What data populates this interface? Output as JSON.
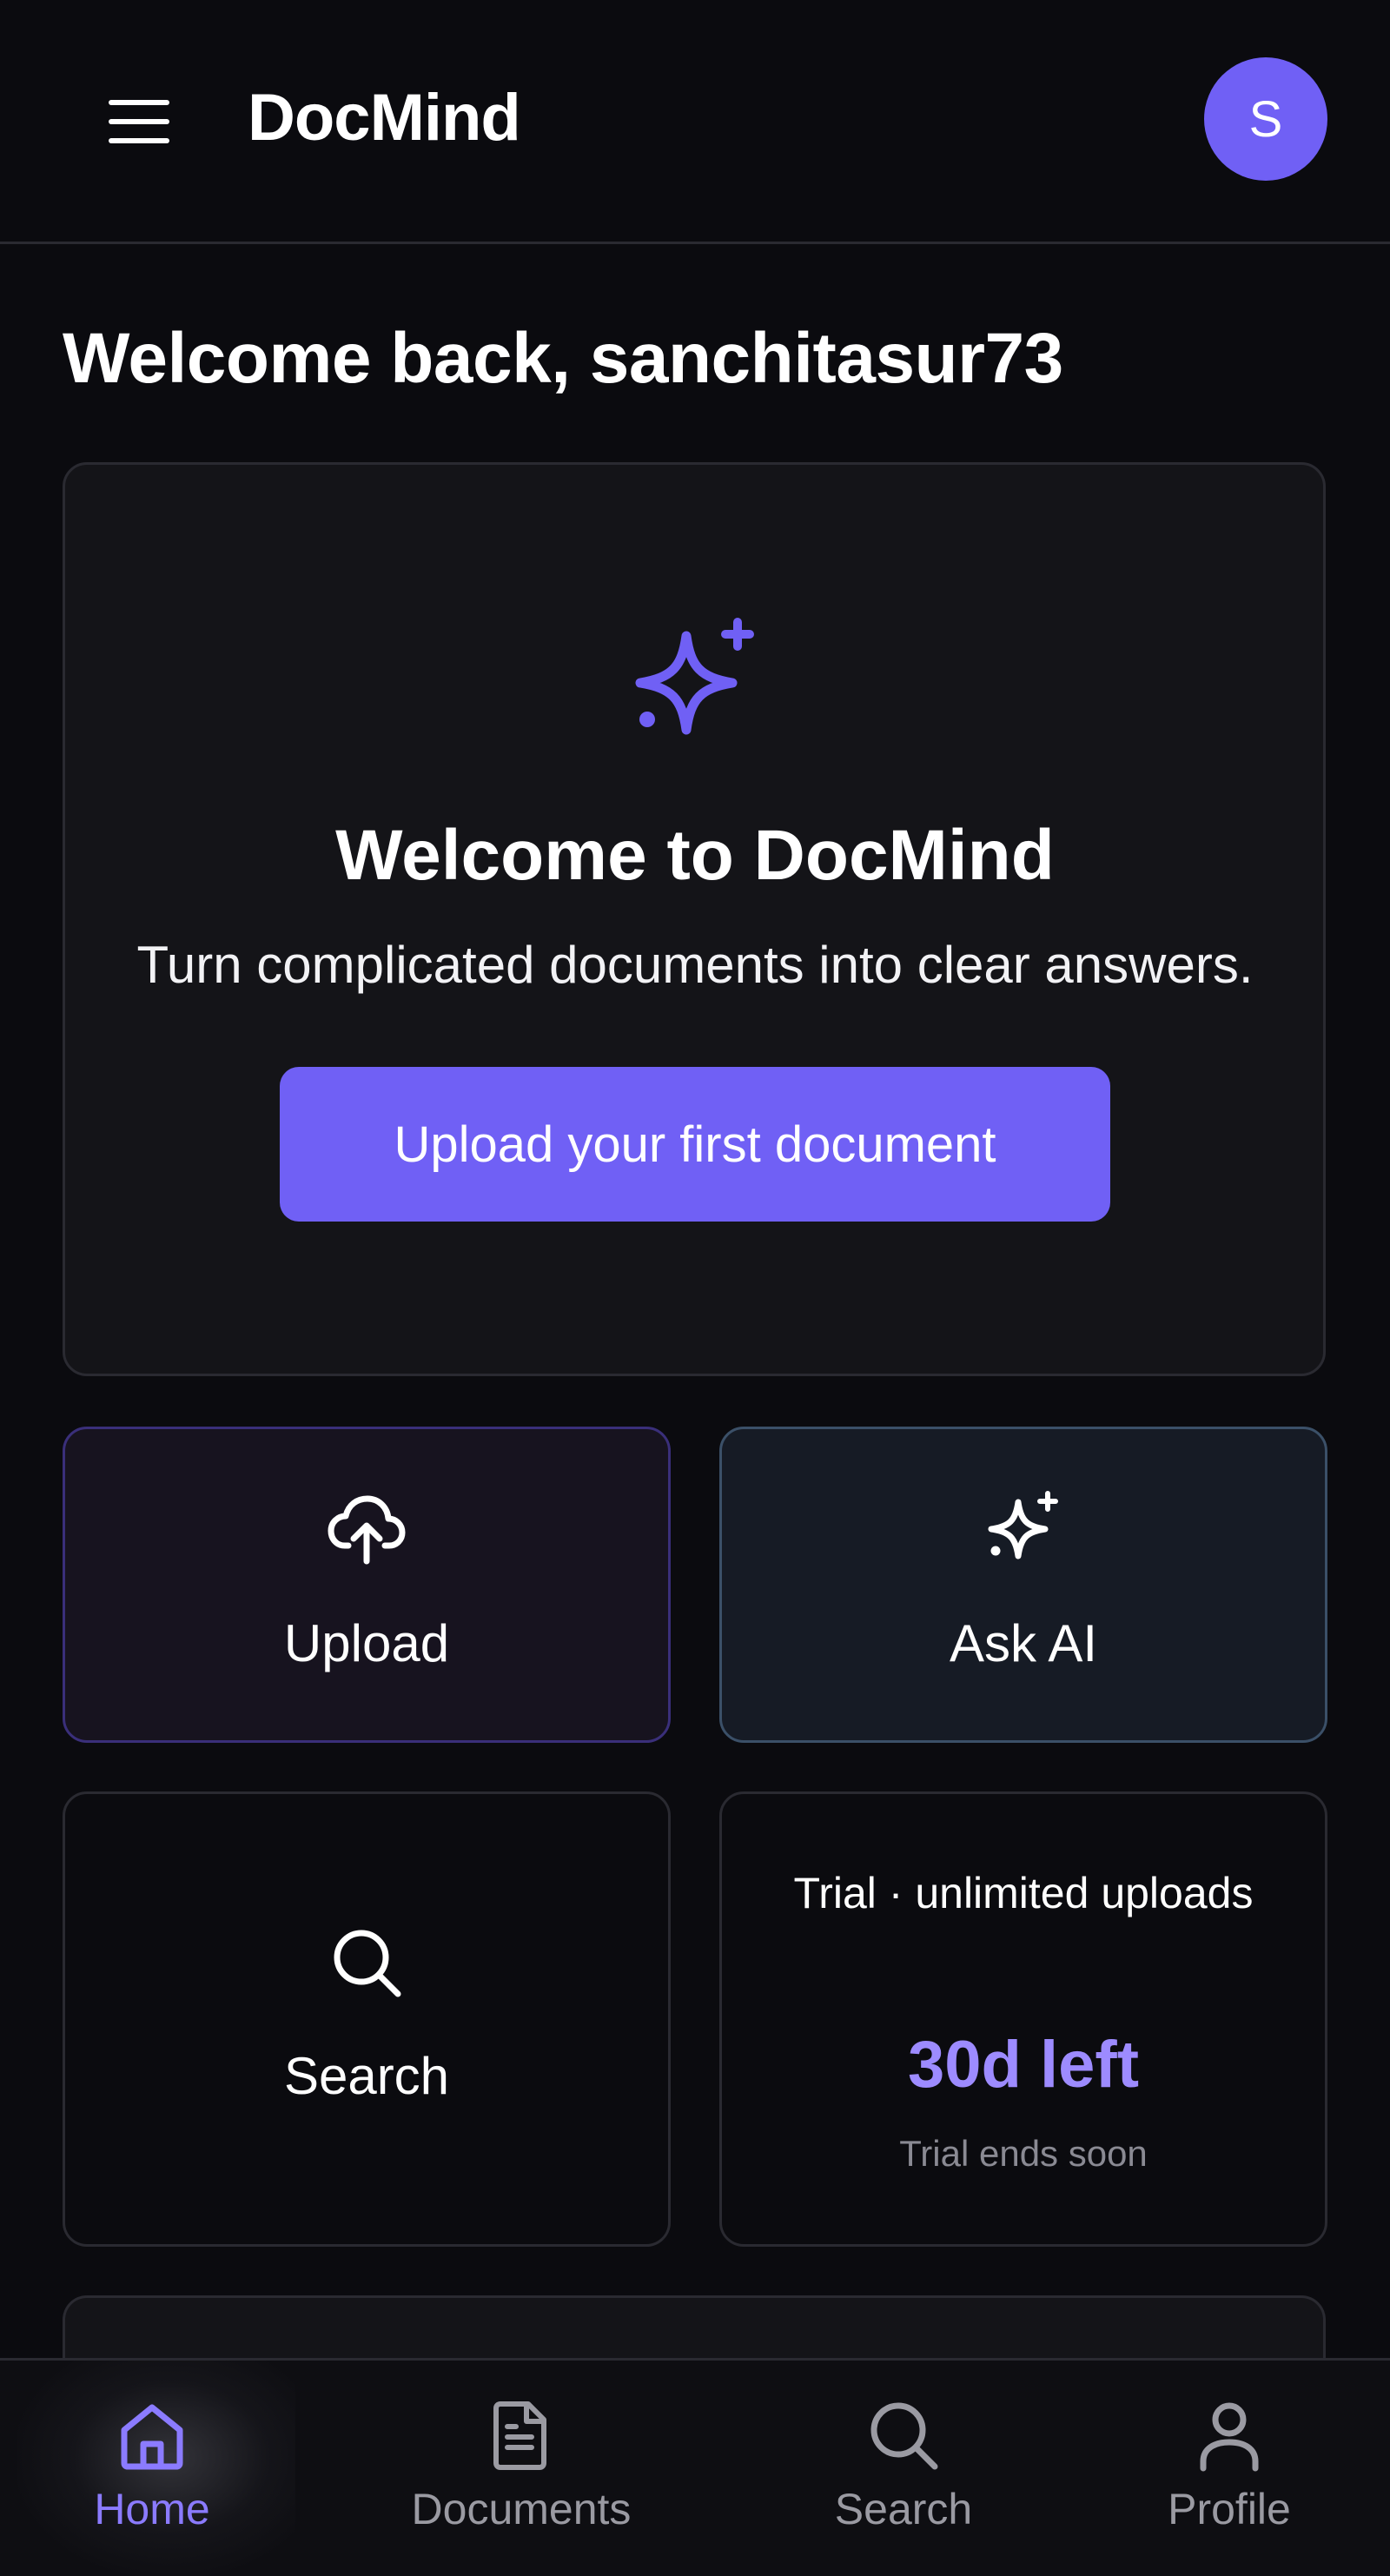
{
  "app": {
    "title": "DocMind"
  },
  "header": {
    "avatar_initial": "S"
  },
  "greeting": "Welcome back, sanchitasur73",
  "hero": {
    "title": "Welcome to DocMind",
    "subtitle": "Turn complicated documents into clear answers.",
    "cta_label": "Upload your first document"
  },
  "tiles": {
    "upload_label": "Upload",
    "ask_label": "Ask AI",
    "search_label": "Search"
  },
  "trial": {
    "plan": "Trial · unlimited uploads",
    "days_left": "30d left",
    "note": "Trial ends soon"
  },
  "bottom_nav": {
    "items": [
      {
        "label": "Home",
        "icon": "home-icon",
        "active": true
      },
      {
        "label": "Documents",
        "icon": "document-icon",
        "active": false
      },
      {
        "label": "Search",
        "icon": "search-icon",
        "active": false
      },
      {
        "label": "Profile",
        "icon": "user-icon",
        "active": false
      }
    ]
  },
  "colors": {
    "background": "#0b0b0f",
    "accent": "#7060f5",
    "accent_text": "#9d8bff",
    "nav_active": "#8b7bff"
  }
}
